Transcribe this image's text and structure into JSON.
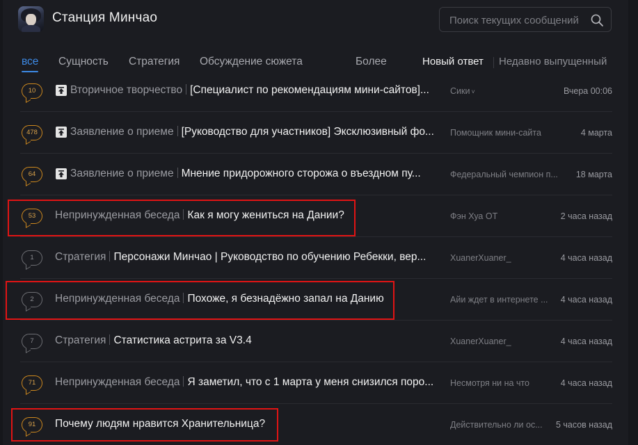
{
  "app": {
    "title": "Станция Минчао",
    "search_placeholder": "Поиск текущих сообщений"
  },
  "tabs": [
    {
      "label": "все",
      "active": true
    },
    {
      "label": "Сущность",
      "active": false
    },
    {
      "label": "Стратегия",
      "active": false
    },
    {
      "label": "Обсуждение сюжета",
      "active": false
    },
    {
      "label": "Более",
      "active": false
    }
  ],
  "sort": {
    "new_reply": "Новый ответ",
    "recently_released": "Недавно выпущенный"
  },
  "posts": [
    {
      "replies": "10",
      "badge_color": "orange",
      "pinned": true,
      "category": "Вторичное творчество",
      "title": "[Специалист по рекомендациям мини-сайтов]...",
      "author": "Сики",
      "author_has_caret": true,
      "time": "Вчера 00:06",
      "highlighted": false
    },
    {
      "replies": "478",
      "badge_color": "orange",
      "pinned": true,
      "category": "Заявление о приеме",
      "title": "[Руководство для участников] Эксклюзивный фо...",
      "author": "Помощник мини-сайта",
      "author_has_caret": false,
      "time": "4 марта",
      "highlighted": false
    },
    {
      "replies": "64",
      "badge_color": "orange",
      "pinned": true,
      "category": "Заявление о приеме",
      "title": "Мнение придорожного сторожа о въездном пу...",
      "author": "Федеральный чемпион п...",
      "author_has_caret": false,
      "time": "18 марта",
      "highlighted": false
    },
    {
      "replies": "53",
      "badge_color": "orange",
      "pinned": false,
      "category": "Непринужденная беседа",
      "title": "Как я могу жениться на Дании?",
      "author": "Фэн Хуа ОТ",
      "author_has_caret": false,
      "time": "2 часа назад",
      "highlighted": true
    },
    {
      "replies": "1",
      "badge_color": "gray",
      "pinned": false,
      "category": "Стратегия",
      "title": "Персонажи Минчао | Руководство по обучению Ребекки, вер...",
      "author": "XuanerXuaner_",
      "author_has_caret": false,
      "time": "4 часа назад",
      "highlighted": false
    },
    {
      "replies": "2",
      "badge_color": "gray",
      "pinned": false,
      "category": "Непринужденная беседа",
      "title": "Похоже, я безнадёжно запал на Данию",
      "author": "Айи ждет в интернете ...",
      "author_has_caret": false,
      "time": "4 часа назад",
      "highlighted": true
    },
    {
      "replies": "7",
      "badge_color": "gray",
      "pinned": false,
      "category": "Стратегия",
      "title": "Статистика астрита за V3.4",
      "author": "XuanerXuaner_",
      "author_has_caret": false,
      "time": "4 часа назад",
      "highlighted": false
    },
    {
      "replies": "71",
      "badge_color": "orange",
      "pinned": false,
      "category": "Непринужденная беседа",
      "title": "Я заметил, что с 1 марта у меня снизился поро...",
      "author": "Несмотря ни на что",
      "author_has_caret": false,
      "time": "4 часа назад",
      "highlighted": false
    },
    {
      "replies": "91",
      "badge_color": "orange",
      "pinned": false,
      "category": "",
      "title": "Почему людям нравится Хранительница?",
      "author": "Действительно ли ос...",
      "author_has_caret": false,
      "time": "5 часов назад",
      "highlighted": true
    }
  ],
  "colors": {
    "accent": "#3d8ae6",
    "badge_orange": "#d08a1e",
    "highlight_red": "#e21414"
  }
}
